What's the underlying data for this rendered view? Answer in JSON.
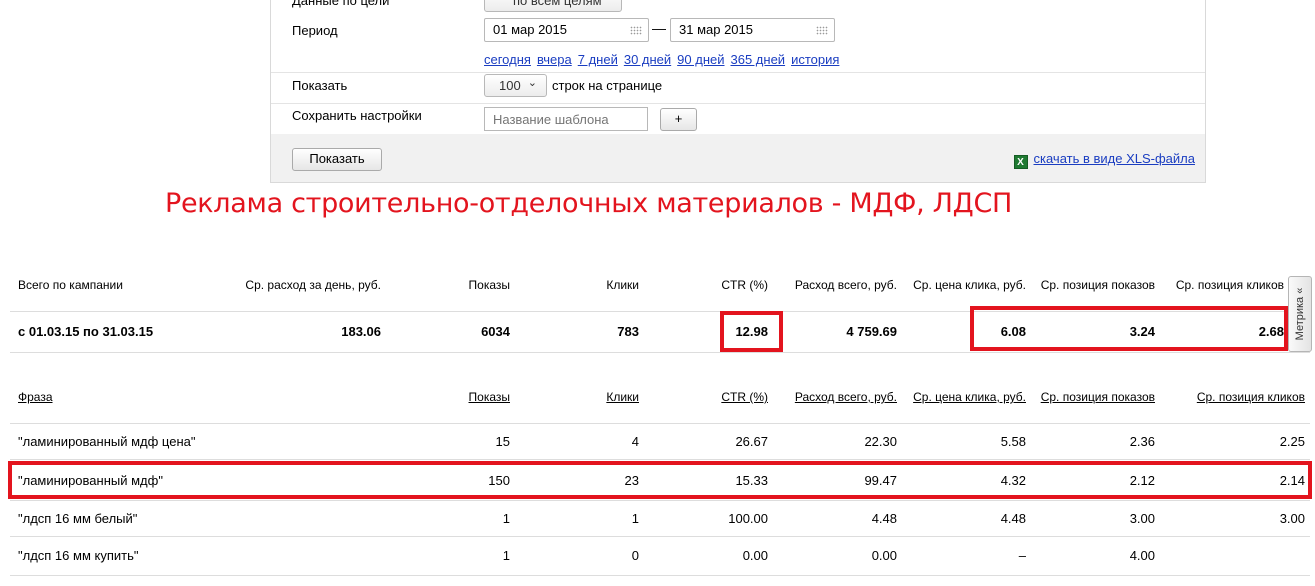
{
  "settings": {
    "goal_label": "Данные по цели",
    "goal_value": "по всем целям",
    "period_label": "Период",
    "date_from": "01 мар 2015",
    "date_to": "31 мар 2015",
    "quick_periods": [
      "сегодня",
      "вчера",
      "7 дней",
      "30 дней",
      "90 дней",
      "365 дней",
      "история"
    ],
    "show_label": "Показать",
    "rows_value": "100",
    "rows_suffix": "строк на странице",
    "save_label": "Сохранить настройки",
    "template_placeholder": "Название шаблона",
    "add_button": "+",
    "show_button": "Показать",
    "xls_link": "скачать в виде XLS-файла"
  },
  "heading": "Реклама строительно-отделочных материалов - МДФ, ЛДСП",
  "campaign_summary": {
    "headers": [
      "Всего по кампании",
      "Ср. расход за день, руб.",
      "Показы",
      "Клики",
      "CTR (%)",
      "Расход всего, руб.",
      "Ср. цена клика, руб.",
      "Ср. позиция показов",
      "Ср. позиция кликов"
    ],
    "row": [
      "с 01.03.15 по 31.03.15",
      "183.06",
      "6034",
      "783",
      "12.98",
      "4 759.69",
      "6.08",
      "3.24",
      "2.68"
    ]
  },
  "phrases": {
    "headers": [
      "Фраза",
      "Показы",
      "Клики",
      "CTR (%)",
      "Расход всего, руб.",
      "Ср. цена клика, руб.",
      "Ср. позиция показов",
      "Ср. позиция кликов"
    ],
    "rows": [
      [
        "\"ламинированный мдф цена\"",
        "15",
        "4",
        "26.67",
        "22.30",
        "5.58",
        "2.36",
        "2.25"
      ],
      [
        "\"ламинированный мдф\"",
        "150",
        "23",
        "15.33",
        "99.47",
        "4.32",
        "2.12",
        "2.14"
      ],
      [
        "\"лдсп 16 мм белый\"",
        "1",
        "1",
        "100.00",
        "4.48",
        "4.48",
        "3.00",
        "3.00"
      ],
      [
        "\"лдсп 16 мм купить\"",
        "1",
        "0",
        "0.00",
        "0.00",
        "–",
        "4.00",
        ""
      ]
    ]
  },
  "metrika_tab": "Метрика «",
  "colors": {
    "highlight": "#e3141e",
    "link": "#1a3dc1"
  },
  "icons": [
    "calendar-icon",
    "chevron-down-icon",
    "excel-icon"
  ]
}
